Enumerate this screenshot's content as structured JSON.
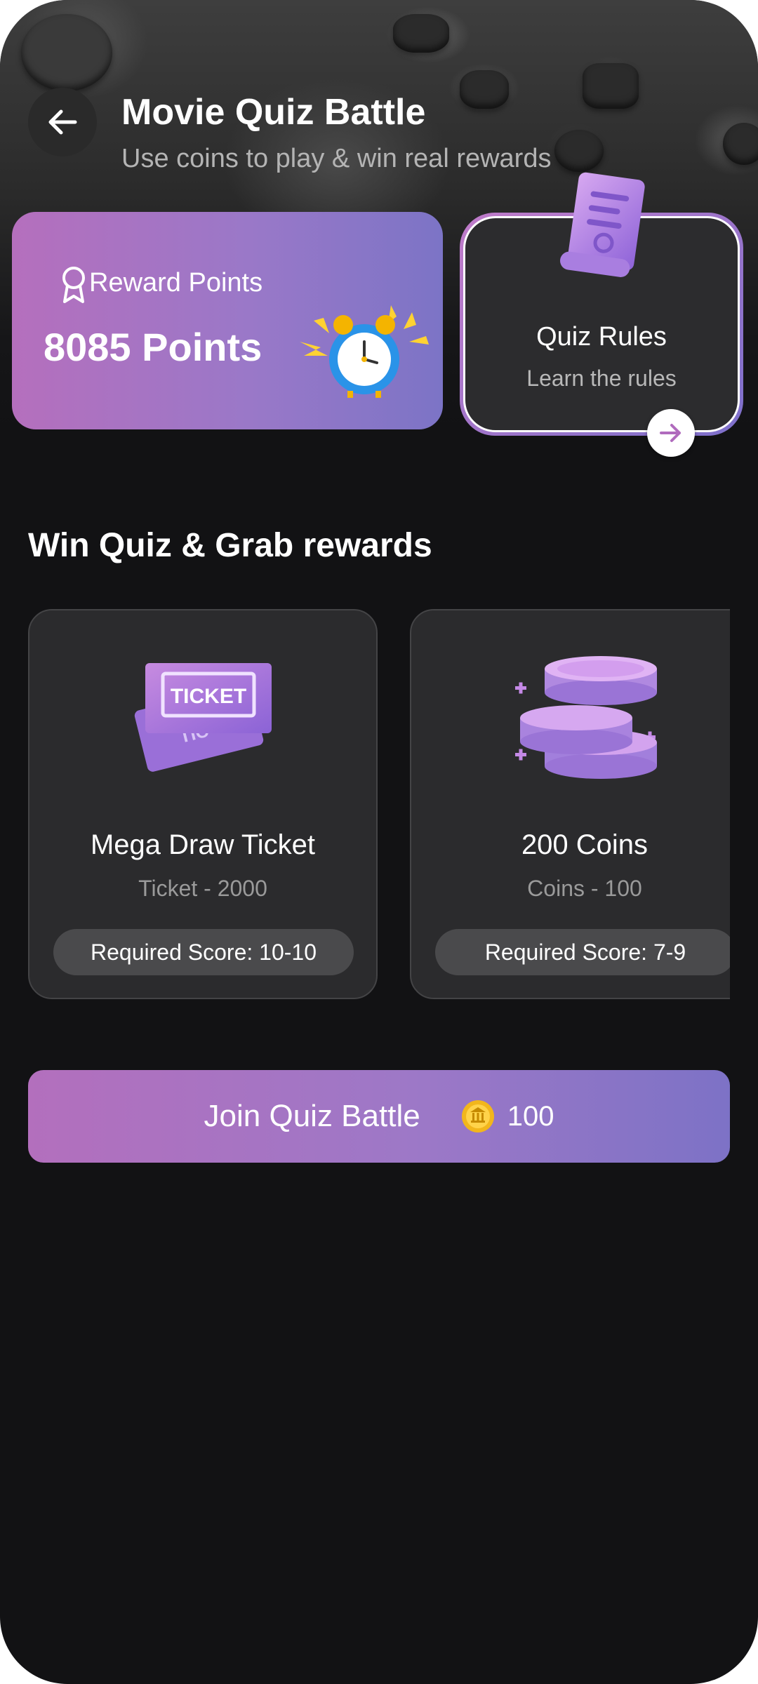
{
  "header": {
    "title": "Movie Quiz Battle",
    "subtitle": "Use coins to play & win real rewards",
    "back_icon": "arrow-left-icon"
  },
  "reward_card": {
    "label": "Reward Points",
    "value": "8085 Points",
    "icon": "ribbon-icon",
    "illustration": "alarm-clock-icon"
  },
  "rules_card": {
    "title": "Quiz Rules",
    "subtitle": "Learn the rules",
    "illustration": "scroll-document-icon",
    "arrow_icon": "arrow-right-icon"
  },
  "rewards_section": {
    "title": "Win Quiz & Grab rewards",
    "items": [
      {
        "name": "Mega Draw Ticket",
        "sub": "Ticket - 2000",
        "score": "Required Score: 10-10",
        "icon": "ticket-icon",
        "ticket_text": "TICKET"
      },
      {
        "name": "200 Coins",
        "sub": "Coins - 100",
        "score": "Required Score: 7-9",
        "icon": "coins-stack-icon"
      }
    ]
  },
  "join_button": {
    "label": "Join Quiz Battle",
    "cost": "100",
    "coin_icon": "coin-icon"
  },
  "colors": {
    "background": "#121214",
    "card": "#2b2b2d",
    "accent_start": "#b56fbd",
    "accent_end": "#7c74c6"
  }
}
